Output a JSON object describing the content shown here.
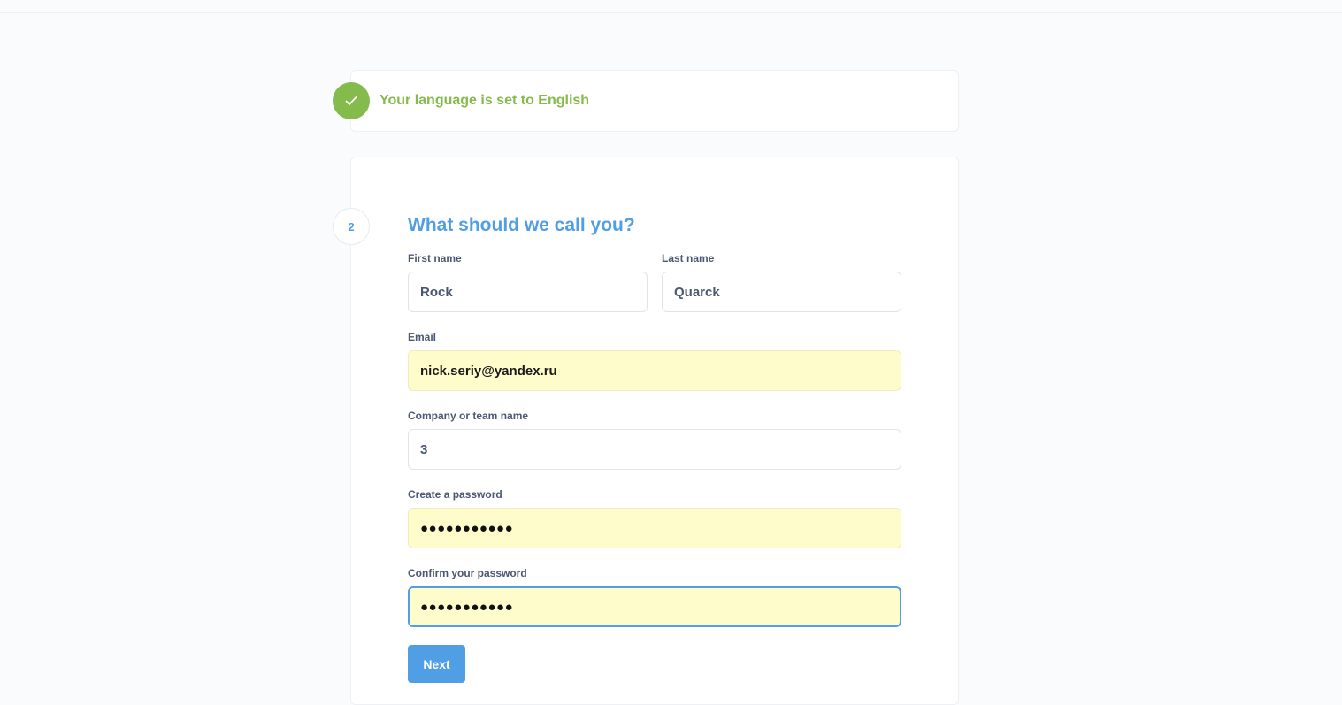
{
  "step1": {
    "status": "Your language is set to English",
    "icon": "checkmark-icon",
    "color": "#84bb4c"
  },
  "step2": {
    "number": "2",
    "title": "What should we call you?",
    "accent": "#509ee3",
    "fields": {
      "first_name": {
        "label": "First name",
        "value": "Rock"
      },
      "last_name": {
        "label": "Last name",
        "value": "Quarck"
      },
      "email": {
        "label": "Email",
        "value": "nick.seriy@yandex.ru"
      },
      "company": {
        "label": "Company or team name",
        "value": "3"
      },
      "password": {
        "label": "Create a password",
        "value": "●●●●●●●●●●●"
      },
      "confirm_password": {
        "label": "Confirm your password",
        "value": "●●●●●●●●●●●"
      }
    },
    "next_label": "Next"
  }
}
